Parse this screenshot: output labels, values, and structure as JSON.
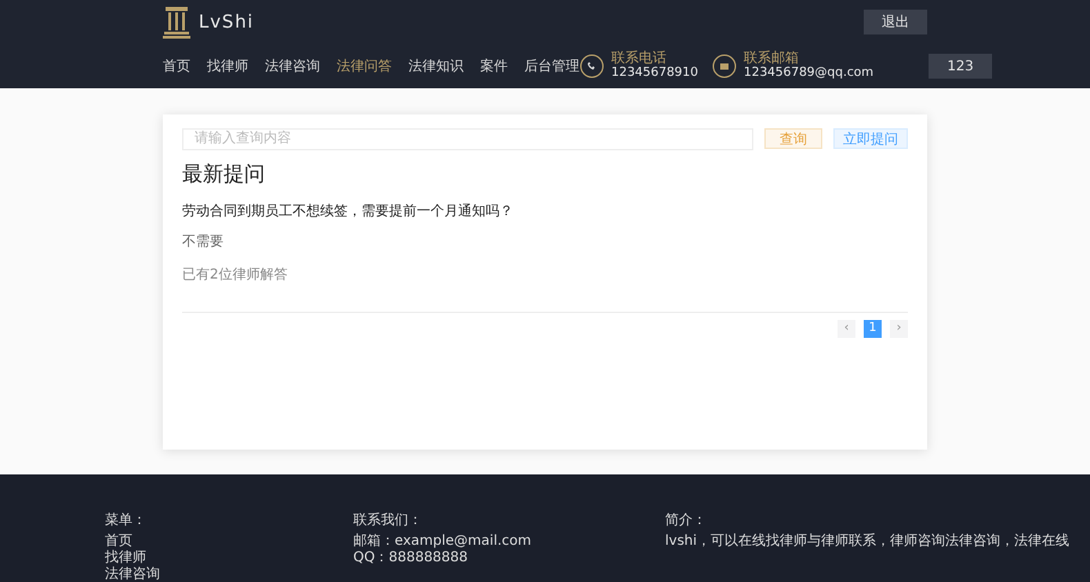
{
  "header": {
    "logo_text": "LvShi",
    "logout_button": "退出",
    "user_button": "123",
    "nav": [
      {
        "label": "首页",
        "selected": false
      },
      {
        "label": "找律师",
        "selected": false
      },
      {
        "label": "法律咨询",
        "selected": false
      },
      {
        "label": "法律问答",
        "selected": true
      },
      {
        "label": "法律知识",
        "selected": false
      },
      {
        "label": "案件",
        "selected": false
      },
      {
        "label": "后台管理",
        "selected": false
      }
    ],
    "contacts": [
      {
        "kind": "phone",
        "label": "联系电话",
        "value": "12345678910"
      },
      {
        "kind": "mail",
        "label": "联系邮箱",
        "value": "123456789@qq.com"
      }
    ]
  },
  "search": {
    "placeholder": "请输入查询内容",
    "query_button": "查询",
    "ask_button": "立即提问"
  },
  "section_title": "最新提问",
  "questions": [
    {
      "title": "劳动合同到期员工不想续签，需要提前一个月通知吗？",
      "answer": "不需要",
      "meta": "已有2位律师解答"
    }
  ],
  "pagination": {
    "prev": "‹",
    "next": "›",
    "pages": [
      {
        "label": "1",
        "selected": true
      }
    ]
  },
  "footer": {
    "menu_title": "菜单：",
    "menu_items": [
      "首页",
      "找律师",
      "法律咨询"
    ],
    "contact_title": "联系我们：",
    "contact_lines": [
      "邮箱：example@mail.com",
      "QQ：888888888"
    ],
    "intro_title": "简介：",
    "intro_text": "lvshi，可以在线找律师与律师联系，律师咨询法律咨询，法律在线"
  }
}
